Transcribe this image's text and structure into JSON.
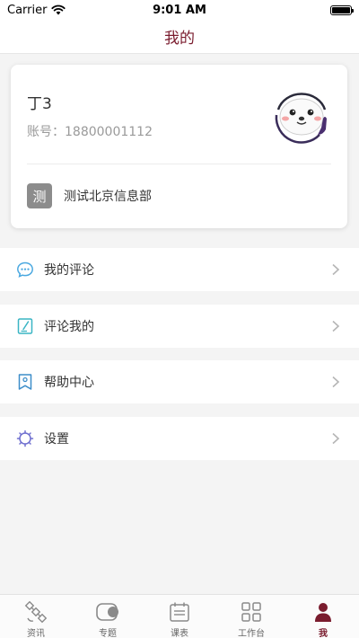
{
  "status_bar": {
    "carrier": "Carrier",
    "time": "9:01 AM",
    "battery_level": 1.0
  },
  "header": {
    "title": "我的"
  },
  "profile": {
    "name": "丁3",
    "account_label": "账号：",
    "account_number": "18800001112",
    "org_badge": "测",
    "org_name": "测试北京信息部"
  },
  "menu": [
    {
      "label": "我的评论",
      "icon": "comment-icon",
      "color": "#4aa8e0"
    },
    {
      "label": "评论我的",
      "icon": "edit-note-icon",
      "color": "#3ab5c4"
    },
    {
      "label": "帮助中心",
      "icon": "help-bookmark-icon",
      "color": "#3d8ec9"
    },
    {
      "label": "设置",
      "icon": "settings-gear-icon",
      "color": "#6f6fcf"
    }
  ],
  "tabs": [
    {
      "label": "资讯",
      "icon": "satellite-icon",
      "active": false
    },
    {
      "label": "专题",
      "icon": "topic-toggle-icon",
      "active": false
    },
    {
      "label": "课表",
      "icon": "schedule-icon",
      "active": false
    },
    {
      "label": "工作台",
      "icon": "grid-icon",
      "active": false
    },
    {
      "label": "我",
      "icon": "person-icon",
      "active": true
    }
  ],
  "colors": {
    "accent": "#7a1c2e",
    "background": "#f4f4f4"
  }
}
